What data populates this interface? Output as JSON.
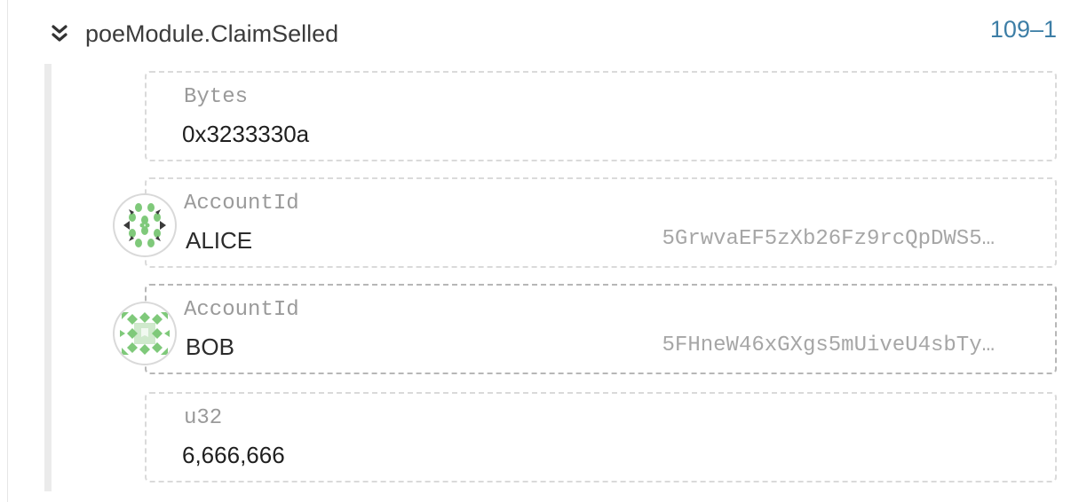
{
  "event": {
    "title": "poeModule.ClaimSelled",
    "block_ref": "109–1",
    "expand_icon": "double-chevron-down-icon"
  },
  "fields": [
    {
      "type": "Bytes",
      "value": "0x3233330a"
    },
    {
      "type": "AccountId",
      "name": "ALICE",
      "address": "5GrwvaEF5zXb26Fz9rcQpDWS5…",
      "avatar_icon": "identicon-alice"
    },
    {
      "type": "AccountId",
      "name": "BOB",
      "address": "5FHneW46xGXgs5mUiveU4sbTy…",
      "avatar_icon": "identicon-bob"
    },
    {
      "type": "u32",
      "value": "6,666,666"
    }
  ],
  "colors": {
    "link": "#3d7ea6",
    "identicon_green": "#7fc97a",
    "identicon_dark": "#3a3a3a"
  }
}
